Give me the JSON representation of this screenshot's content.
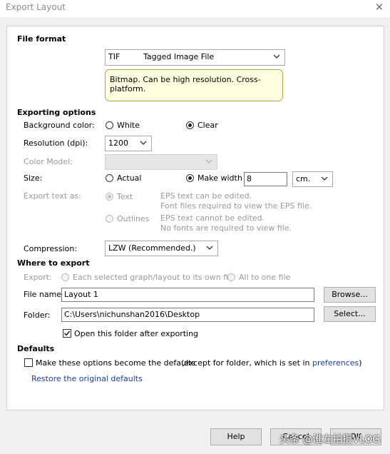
{
  "window": {
    "title": "Export Layout"
  },
  "file_format": {
    "heading": "File format",
    "selected_code": "TIF",
    "selected_name": "Tagged Image File",
    "note": "Bitmap. Can be high resolution. Cross-platform."
  },
  "exporting_options": {
    "heading": "Exporting options",
    "background_label": "Background color:",
    "background_white": "White",
    "background_clear": "Clear",
    "background_selected": "Clear",
    "resolution_label": "Resolution (dpi):",
    "resolution_value": "1200",
    "color_model_label": "Color Model:",
    "color_model_value": "",
    "size_label": "Size:",
    "size_actual": "Actual",
    "size_make_width": "Make width",
    "size_selected": "Make width",
    "width_value": "8",
    "unit_value": "cm.",
    "export_text_label": "Export text as:",
    "text_option": "Text",
    "text_desc_1": "EPS text can be edited.",
    "text_desc_2": "Font files required to view the EPS file.",
    "outlines_option": "Outlines",
    "outlines_desc_1": "EPS text cannot be edited.",
    "outlines_desc_2": "No fonts are required to view file.",
    "compression_label": "Compression:",
    "compression_value": "LZW (Recommended.)"
  },
  "where_to_export": {
    "heading": "Where to export",
    "export_label": "Export:",
    "each_option": "Each selected graph/layout to its own file",
    "all_option": "All to one file",
    "file_name_label": "File name:",
    "file_name_value": "Layout 1",
    "browse_button": "Browse...",
    "folder_label": "Folder:",
    "folder_value": "C:\\Users\\nichunshan2016\\Desktop",
    "select_button": "Select...",
    "open_folder_label": "Open this folder after exporting",
    "open_folder_checked": true
  },
  "defaults": {
    "heading": "Defaults",
    "make_default_label": "Make these options become the defaults",
    "make_default_note": "(except for folder, which is set in",
    "preferences_link": "preferences",
    "make_default_note_end": ")",
    "restore_link": "Restore the original defaults"
  },
  "footer": {
    "help_button": "Help",
    "cancel_button": "Cancel",
    "ok_button": "OK",
    "watermark": "头条 @淮左拍摄VLOG"
  },
  "colors": {
    "accent_link": "#1a3ea8",
    "note_bg": "#ffffe1",
    "note_border": "#b7a33a"
  }
}
